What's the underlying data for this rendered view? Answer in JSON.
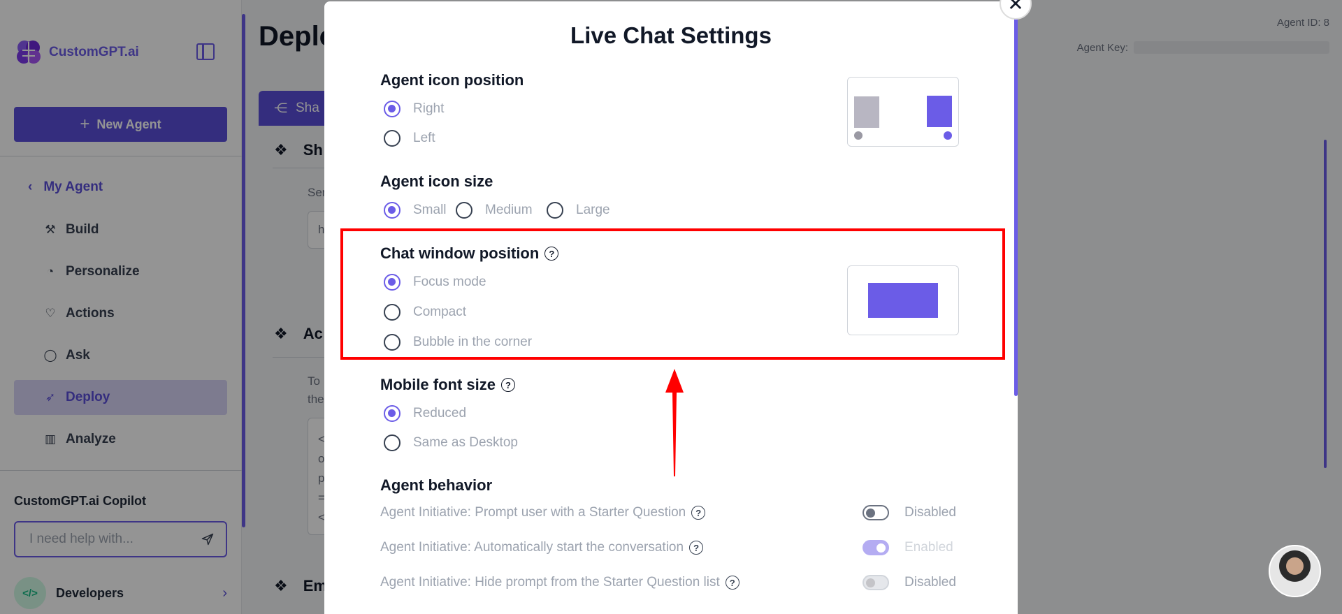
{
  "sidebar": {
    "logo_text": "CustomGPT.ai",
    "new_agent_label": "New Agent",
    "my_agent_label": "My Agent",
    "nav": [
      {
        "label": "Build",
        "icon": "build-icon"
      },
      {
        "label": "Personalize",
        "icon": "palette-icon"
      },
      {
        "label": "Actions",
        "icon": "actions-icon"
      },
      {
        "label": "Ask",
        "icon": "chat-icon"
      },
      {
        "label": "Deploy",
        "icon": "rocket-icon",
        "active": true
      },
      {
        "label": "Analyze",
        "icon": "chart-icon"
      }
    ],
    "copilot_label": "CustomGPT.ai Copilot",
    "copilot_placeholder": "I need help with...",
    "developers_label": "Developers",
    "developers_badge": "</>"
  },
  "main": {
    "title": "Deplo",
    "agent_id_label": "Agent ID: 8",
    "agent_key_label": "Agent Key:",
    "share_tab_label": "Sha",
    "sections": [
      {
        "title": "Sh"
      },
      {
        "title": "Ac"
      },
      {
        "title": "Em"
      }
    ],
    "snippets": [
      "Ser",
      "h",
      "To",
      "the",
      "<",
      "o",
      "p",
      "=",
      "<"
    ]
  },
  "modal": {
    "title": "Live Chat Settings",
    "icon_position": {
      "title": "Agent icon position",
      "options": [
        "Right",
        "Left"
      ],
      "selected": "Right"
    },
    "icon_size": {
      "title": "Agent icon size",
      "options": [
        "Small",
        "Medium",
        "Large"
      ],
      "selected": "Small"
    },
    "window_position": {
      "title": "Chat window position",
      "options": [
        "Focus mode",
        "Compact",
        "Bubble in the corner"
      ],
      "selected": "Focus mode"
    },
    "mobile_font": {
      "title": "Mobile font size",
      "options": [
        "Reduced",
        "Same as Desktop"
      ],
      "selected": "Reduced"
    },
    "behavior": {
      "title": "Agent behavior",
      "rows": [
        {
          "label": "Agent Initiative: Prompt user with a Starter Question",
          "state": "Disabled",
          "on": false
        },
        {
          "label": "Agent Initiative: Automatically start the conversation",
          "state": "Enabled",
          "on": true
        },
        {
          "label": "Agent Initiative: Hide prompt from the Starter Question list",
          "state": "Disabled",
          "on": false
        }
      ]
    }
  },
  "colors": {
    "accent": "#6b5ce7",
    "highlight": "#ff0000"
  }
}
